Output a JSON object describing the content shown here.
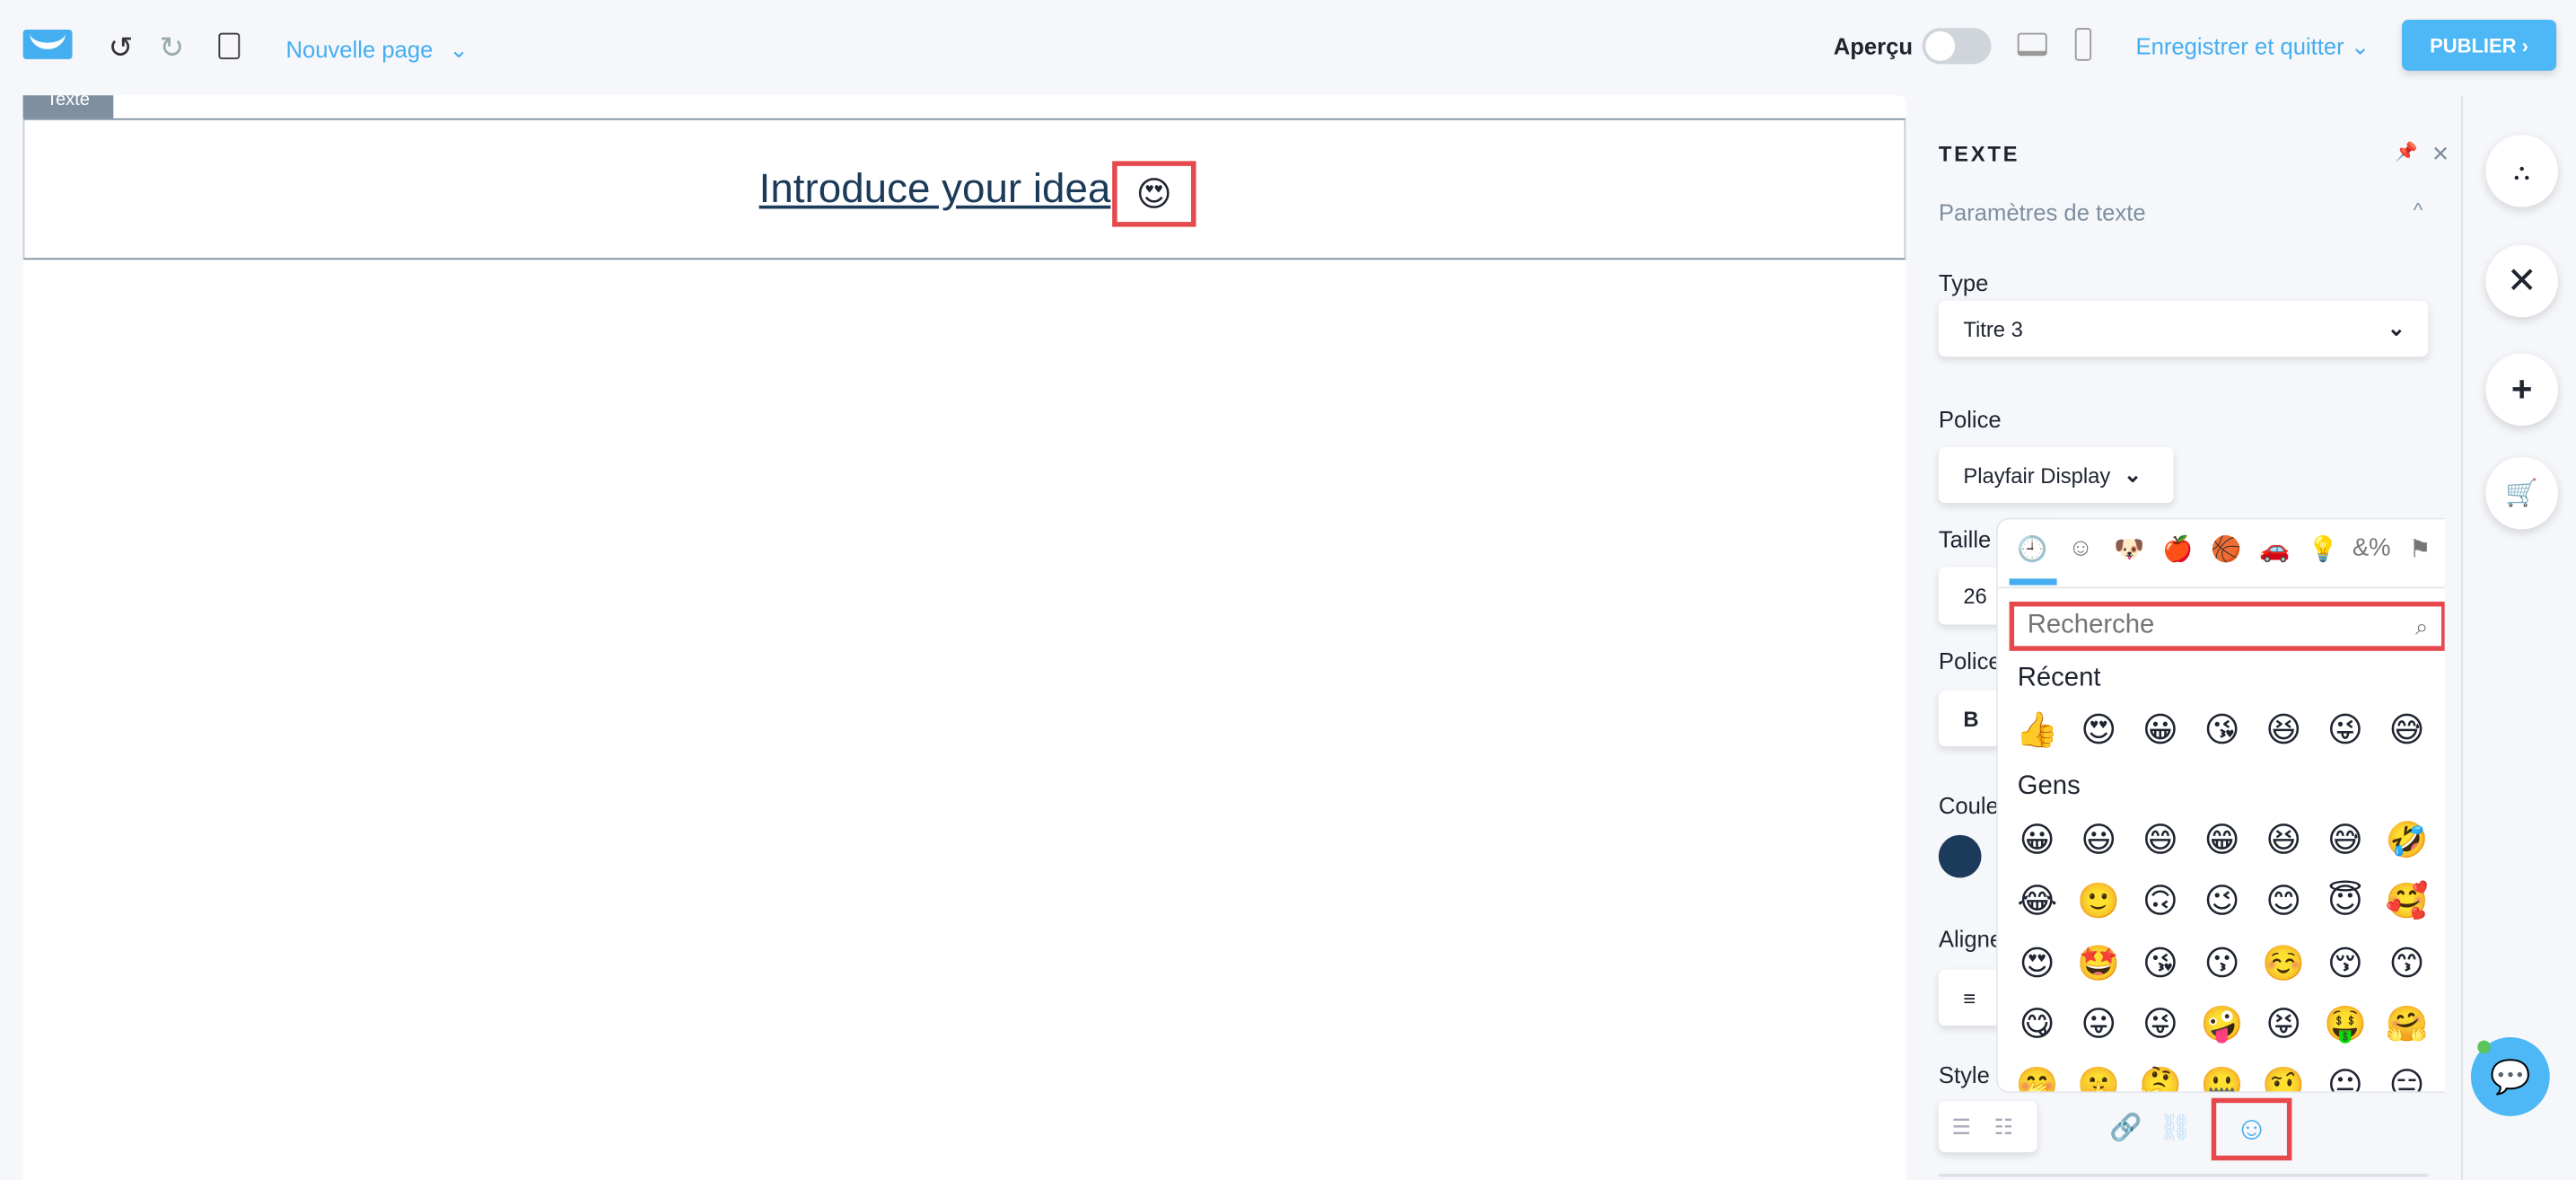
{
  "toolbar": {
    "page_name": "Nouvelle page",
    "preview_label": "Aperçu",
    "save_quit_label": "Enregistrer et quitter",
    "publish_label": "PUBLIER"
  },
  "canvas": {
    "section_tab": "Texte",
    "heading": "Introduce your idea",
    "heading_emoji": "😍"
  },
  "panel": {
    "title": "TEXTE",
    "section": "Paramètres de texte",
    "type_label": "Type",
    "type_value": "Titre 3",
    "font_label": "Police",
    "font_value": "Playfair Display",
    "size_label": "Taille",
    "size_value": "26",
    "style_font_label": "Police",
    "bold_label": "B",
    "color_label": "Couleur",
    "color_value": "#1c3a5a",
    "align_label": "Alignement",
    "style_label": "Style"
  },
  "emoji_picker": {
    "search_placeholder": "Recherche",
    "categories": [
      "recent",
      "smileys",
      "animals",
      "food",
      "activity",
      "travel",
      "objects",
      "symbols",
      "flags"
    ],
    "recent_label": "Récent",
    "recent": [
      "👍",
      "😍",
      "😀",
      "😘",
      "😆",
      "😜",
      "😅"
    ],
    "people_label": "Gens",
    "people": [
      "😀",
      "😃",
      "😄",
      "😁",
      "😆",
      "😅",
      "🤣",
      "😂",
      "🙂",
      "🙃",
      "😉",
      "😊",
      "😇",
      "🥰",
      "😍",
      "🤩",
      "😘",
      "😗",
      "☺️",
      "😚",
      "😙",
      "😋",
      "😛",
      "😜",
      "🤪",
      "😝",
      "🤑",
      "🤗",
      "🤭",
      "🤫",
      "🤔",
      "🤐",
      "🤨",
      "😐",
      "😑"
    ]
  },
  "colors": {
    "accent": "#45aef0",
    "highlight": "#e5484d",
    "heading": "#1c3a5a"
  }
}
